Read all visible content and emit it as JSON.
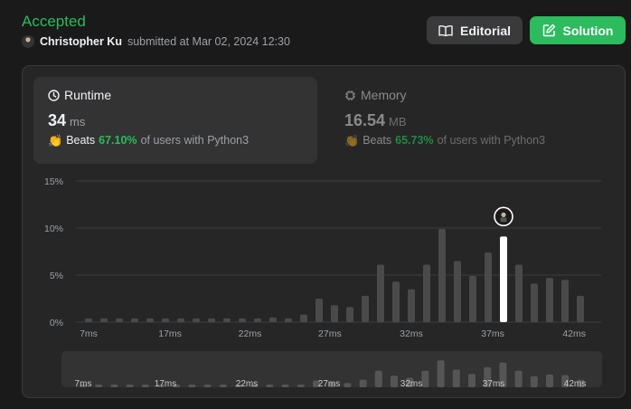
{
  "submission": {
    "status": "Accepted",
    "user": "Christopher Ku",
    "submitted_text": "submitted at Mar 02, 2024 12:30"
  },
  "buttons": {
    "editorial": "Editorial",
    "solution": "Solution"
  },
  "runtime": {
    "label": "Runtime",
    "value": "34",
    "unit": "ms",
    "beats_label": "Beats",
    "beats_pct": "67.10%",
    "beats_suffix": "of users with Python3"
  },
  "memory": {
    "label": "Memory",
    "value": "16.54",
    "unit": "MB",
    "beats_label": "Beats",
    "beats_pct": "65.73%",
    "beats_suffix": "of users with Python3"
  },
  "icons": {
    "clock": "clock-icon",
    "memory": "memory-chip-icon",
    "book": "book-icon",
    "edit": "edit-icon",
    "clap": "clapping-hands-icon"
  },
  "colors": {
    "accent_green": "#2cbb5d",
    "bar_default": "#4a4a4a",
    "bar_selected": "#ffffff"
  },
  "chart_data": {
    "type": "bar",
    "yticks": [
      "15%",
      "10%",
      "5%",
      "0%"
    ],
    "ylim": [
      0,
      15
    ],
    "x_tick_labels": [
      "7ms",
      "17ms",
      "22ms",
      "27ms",
      "32ms",
      "37ms",
      "42ms"
    ],
    "x": [
      7,
      8,
      9,
      10,
      11,
      12,
      13,
      14,
      15,
      16,
      17,
      18,
      19,
      20,
      21,
      22,
      23,
      24,
      25,
      26,
      27,
      28,
      29,
      30,
      31,
      32,
      33,
      34,
      35,
      36,
      37,
      38,
      39,
      40,
      41,
      42,
      43
    ],
    "values": [
      0.4,
      0.4,
      0.4,
      0.4,
      0.4,
      0.4,
      0.4,
      0.4,
      0.4,
      0.4,
      0.4,
      0.4,
      0.5,
      0.4,
      0.8,
      2.5,
      1.8,
      1.6,
      2.8,
      6.1,
      4.3,
      3.5,
      6.1,
      9.9,
      6.5,
      4.9,
      7.4,
      9.1,
      6.1,
      4.1,
      4.7,
      4.5,
      2.8
    ],
    "selected_x": 34,
    "overview_x_tick_labels": [
      "7ms",
      "17ms",
      "22ms",
      "27ms",
      "32ms",
      "37ms",
      "42ms"
    ]
  }
}
